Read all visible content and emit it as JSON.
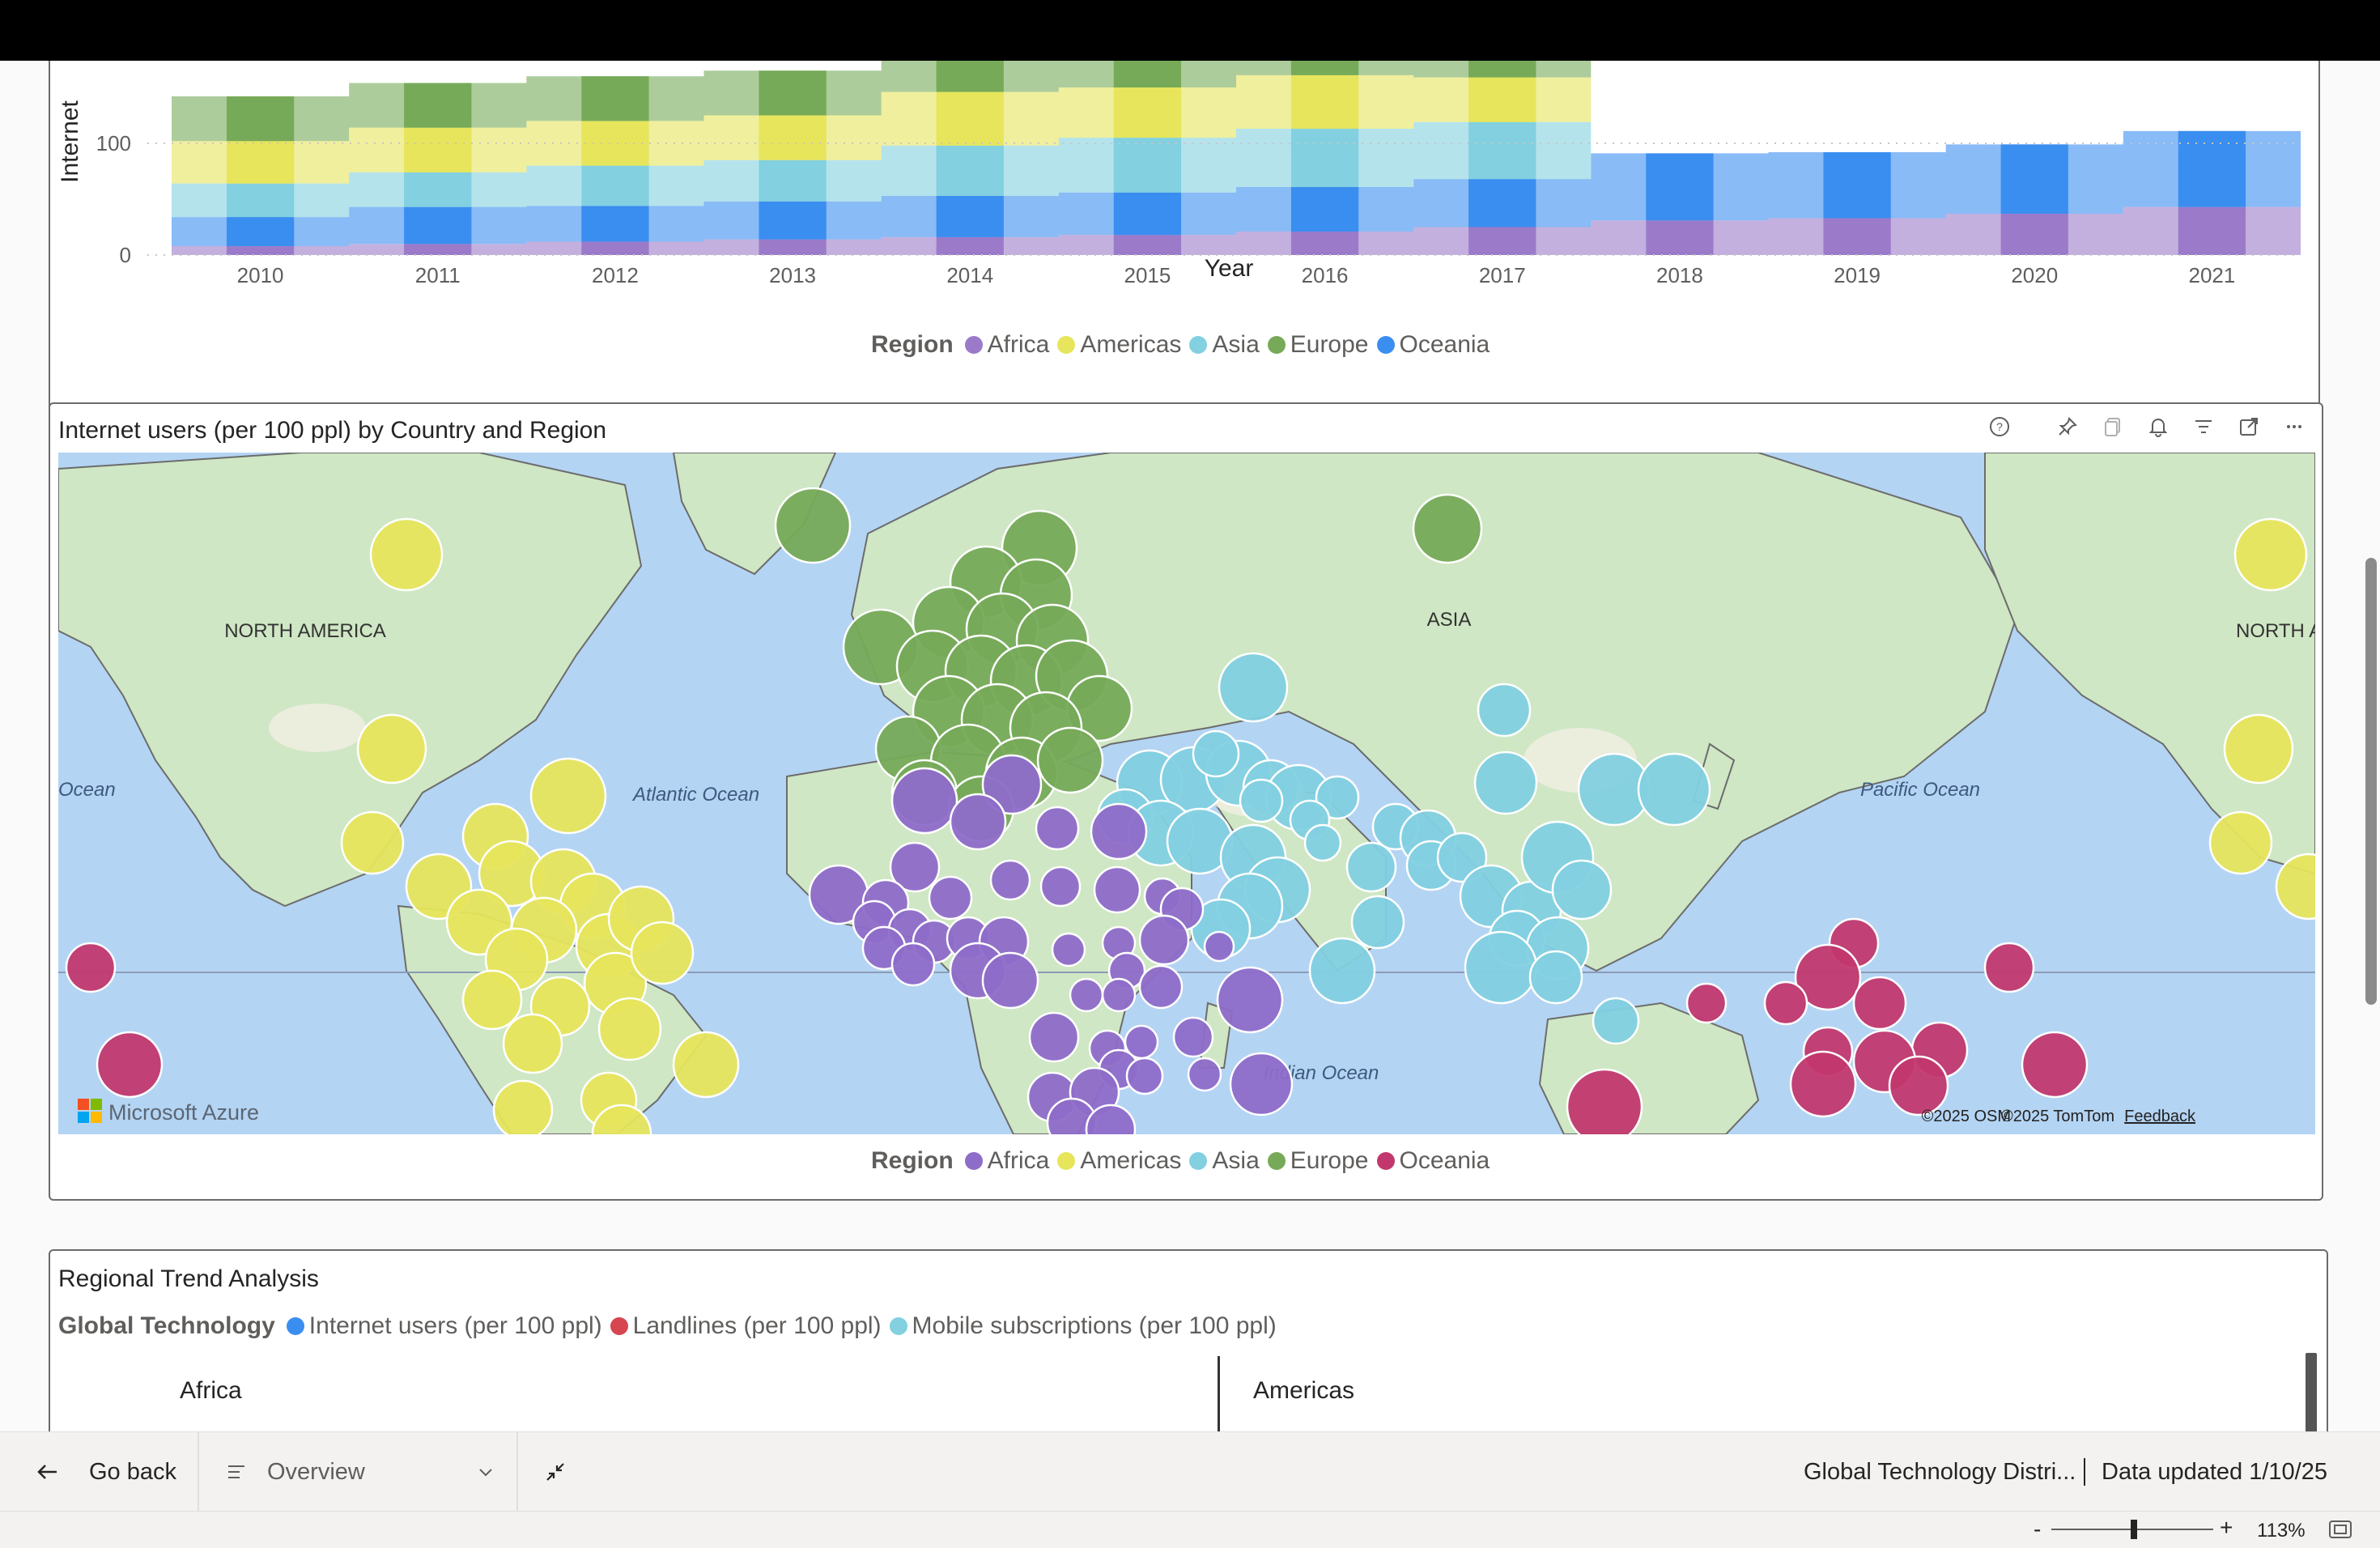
{
  "stream_chart": {
    "y_axis_label": "Internet",
    "x_axis_title": "Year",
    "legend_title": "Region",
    "chart_data": {
      "type": "area",
      "x": [
        "2010",
        "2011",
        "2012",
        "2013",
        "2014",
        "2015",
        "2016",
        "2017",
        "2018",
        "2019",
        "2020",
        "2021"
      ],
      "y_ticks": [
        "0",
        "100"
      ],
      "ylim": [
        0,
        145
      ],
      "series": [
        {
          "name": "Africa",
          "color": "#9b7bc9",
          "values": [
            8,
            10,
            12,
            14,
            16,
            18,
            21,
            25,
            31,
            33,
            37,
            43
          ]
        },
        {
          "name": "Oceania",
          "color": "#3a8ef0",
          "values": [
            26,
            33,
            32,
            34,
            37,
            38,
            40,
            43,
            60,
            59,
            62,
            68
          ]
        },
        {
          "name": "Asia",
          "color": "#82d0e0",
          "values": [
            30,
            31,
            36,
            37,
            45,
            49,
            52,
            51,
            0,
            0,
            0,
            0
          ]
        },
        {
          "name": "Americas",
          "color": "#e6e55c",
          "values": [
            38,
            40,
            40,
            40,
            48,
            45,
            48,
            40,
            0,
            0,
            0,
            0
          ]
        },
        {
          "name": "Europe",
          "color": "#76aa58",
          "values": [
            40,
            40,
            40,
            40,
            40,
            40,
            40,
            40,
            0,
            0,
            0,
            0
          ]
        }
      ]
    }
  },
  "map_visual": {
    "title": "Internet users (per 100 ppl) by Country and Region",
    "legend_title": "Region",
    "legend": [
      {
        "name": "Africa",
        "color": "#8e6cc9"
      },
      {
        "name": "Americas",
        "color": "#e6e55c"
      },
      {
        "name": "Asia",
        "color": "#82d0e0"
      },
      {
        "name": "Europe",
        "color": "#76aa58"
      },
      {
        "name": "Oceania",
        "color": "#c2386e"
      }
    ],
    "toolbar_icons": [
      "help-icon",
      "pin-icon",
      "copy-icon",
      "bell-icon",
      "filter-icon",
      "focus-mode-icon",
      "more-options-icon"
    ],
    "map_labels": {
      "north_america": "NORTH AMERICA",
      "north_america_right": "NORTH AMERIC",
      "asia": "ASIA",
      "atlantic": "Atlantic Ocean",
      "pacific": "Pacific Ocean",
      "indian": "Indian Ocean",
      "ocean_left": "Ocean"
    },
    "attribution": {
      "brand": "Microsoft Azure",
      "osm": "©2025 OSM",
      "tomtom": "©2025 TomTom",
      "feedback": "Feedback"
    }
  },
  "trend_visual": {
    "title": "Regional Trend Analysis",
    "legend_title": "Global Technology",
    "legend": [
      {
        "name": "Internet users (per 100 ppl)",
        "color": "#3a8ef0"
      },
      {
        "name": "Landlines (per 100 ppl)",
        "color": "#d64550"
      },
      {
        "name": "Mobile subscriptions (per 100 ppl)",
        "color": "#82d0e0"
      }
    ],
    "panels": [
      "Africa",
      "Americas"
    ]
  },
  "bottom_bar": {
    "go_back": "Go back",
    "page_name": "Overview",
    "report_name": "Global Technology Distri...",
    "data_updated": "Data updated 1/10/25"
  },
  "status_bar": {
    "zoom_minus": "-",
    "zoom_plus": "+",
    "zoom_level": "113%"
  }
}
